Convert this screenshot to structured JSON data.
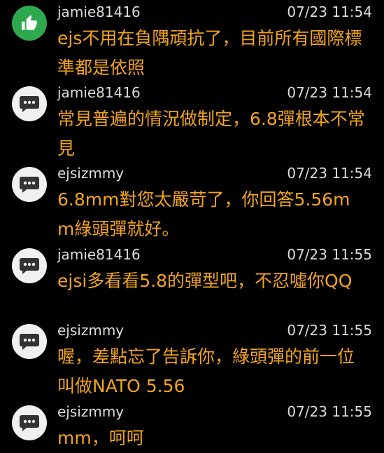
{
  "comments": [
    {
      "username": "jamie81416",
      "time": "07/23 11:54",
      "text": "ejs不用在負隅頑抗了，目前所有國際標準都是依照",
      "icon": "thumbs-up-icon"
    },
    {
      "username": "jamie81416",
      "time": "07/23 11:54",
      "text": "常見普遍的情況做制定，6.8彈根本不常見",
      "icon": "chat-bubble-icon"
    },
    {
      "username": "ejsizmmy",
      "time": "07/23 11:54",
      "text": "6.8mm對您太嚴苛了，你回答5.56mm綠頭彈就好。",
      "icon": "chat-bubble-icon"
    },
    {
      "username": "jamie81416",
      "time": "07/23 11:55",
      "text": "ejsi多看看5.8的彈型吧，不忍噓你QQ",
      "icon": "chat-bubble-icon"
    },
    {
      "username": "ejsizmmy",
      "time": "07/23 11:55",
      "text": "喔，差點忘了告訴你，綠頭彈的前一位叫做NATO 5.56",
      "icon": "chat-bubble-icon"
    },
    {
      "username": "ejsizmmy",
      "time": "07/23 11:55",
      "text": "mm，呵呵",
      "icon": "chat-bubble-icon"
    }
  ],
  "colors": {
    "background": "#000000",
    "meta_text": "#dcdcdc",
    "comment_text": "#f2a51c",
    "like_avatar": "#2fa94f",
    "chat_avatar": "#f0f0f0"
  }
}
